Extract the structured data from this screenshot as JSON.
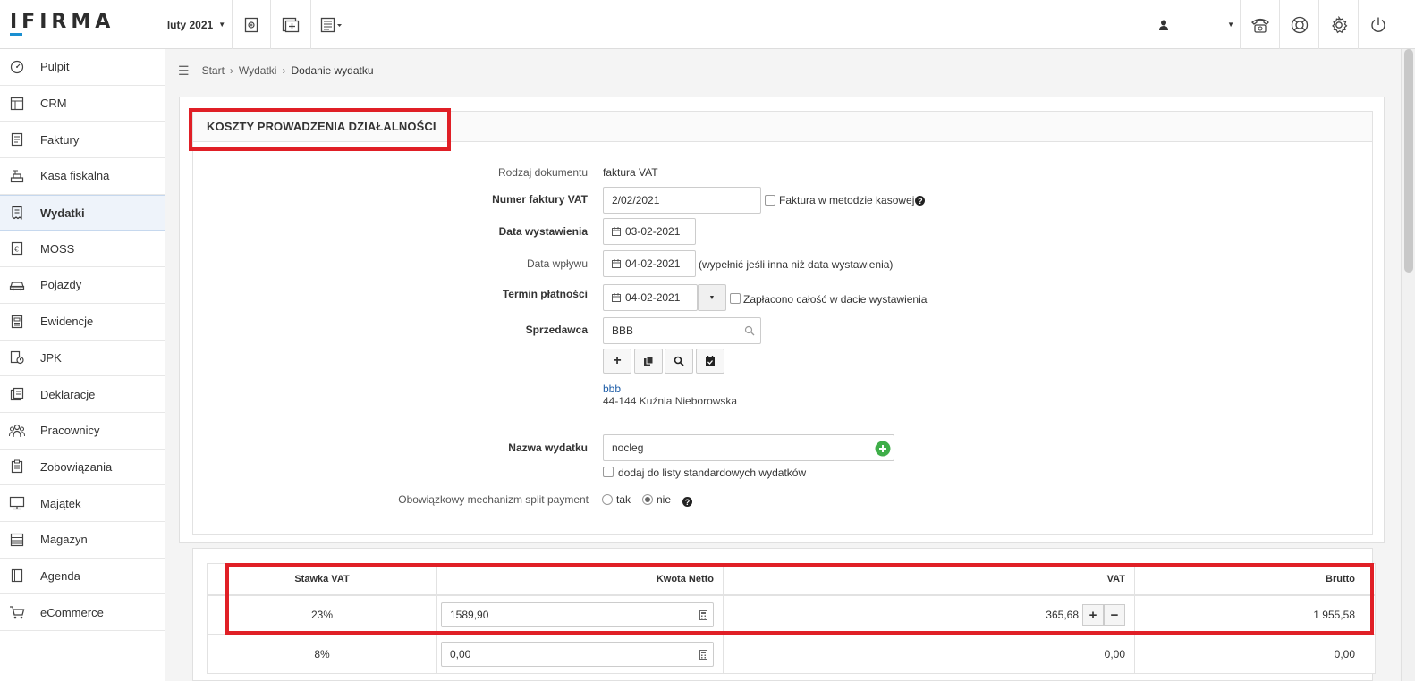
{
  "app": {
    "logo": "IFIRMA",
    "period": "luty 2021"
  },
  "sidebar": {
    "items": [
      {
        "label": "Pulpit",
        "icon": "dashboard-icon"
      },
      {
        "label": "CRM",
        "icon": "crm-icon"
      },
      {
        "label": "Faktury",
        "icon": "invoice-icon"
      },
      {
        "label": "Kasa fiskalna",
        "icon": "cash-register-icon"
      },
      {
        "label": "Wydatki",
        "icon": "receipt-icon",
        "active": true
      },
      {
        "label": "MOSS",
        "icon": "moss-icon"
      },
      {
        "label": "Pojazdy",
        "icon": "car-icon"
      },
      {
        "label": "Ewidencje",
        "icon": "ledger-icon"
      },
      {
        "label": "JPK",
        "icon": "jpk-icon"
      },
      {
        "label": "Deklaracje",
        "icon": "declaration-icon"
      },
      {
        "label": "Pracownicy",
        "icon": "employees-icon"
      },
      {
        "label": "Zobowiązania",
        "icon": "obligations-icon"
      },
      {
        "label": "Majątek",
        "icon": "assets-icon"
      },
      {
        "label": "Magazyn",
        "icon": "warehouse-icon"
      },
      {
        "label": "Agenda",
        "icon": "agenda-icon"
      },
      {
        "label": "eCommerce",
        "icon": "cart-icon"
      }
    ]
  },
  "breadcrumb": {
    "start": "Start",
    "expenses": "Wydatki",
    "current": "Dodanie wydatku"
  },
  "section": {
    "title": "KOSZTY PROWADZENIA DZIAŁALNOŚCI"
  },
  "form": {
    "doc_type_label": "Rodzaj dokumentu",
    "doc_type_value": "faktura VAT",
    "invoice_no_label": "Numer faktury VAT",
    "invoice_no_value": "2/02/2021",
    "cash_method_label": "Faktura w metodzie kasowej",
    "issue_date_label": "Data wystawienia",
    "issue_date_value": "03-02-2021",
    "receipt_date_label": "Data wpływu",
    "receipt_date_value": "04-02-2021",
    "receipt_date_hint": "(wypełnić jeśli inna niż data wystawienia)",
    "due_date_label": "Termin płatności",
    "due_date_value": "04-02-2021",
    "paid_label": "Zapłacono całość w dacie wystawienia",
    "seller_label": "Sprzedawca",
    "seller_value": "BBB",
    "seller_link": "bbb",
    "seller_address": "44-144 Kuźnia Nieborowska",
    "expense_name_label": "Nazwa wydatku",
    "expense_name_value": "nocleg",
    "add_standard_label": "dodaj do listy standardowych wydatków",
    "split_payment_label": "Obowiązkowy mechanizm split payment",
    "split_yes": "tak",
    "split_no": "nie",
    "split_selected": "nie"
  },
  "vat_table": {
    "headers": {
      "rate": "Stawka VAT",
      "net": "Kwota Netto",
      "vat": "VAT",
      "gross": "Brutto"
    },
    "rows": [
      {
        "rate": "23%",
        "net": "1589,90",
        "vat": "365,68",
        "gross": "1 955,58"
      },
      {
        "rate": "8%",
        "net": "0,00",
        "vat": "0,00",
        "gross": "0,00"
      }
    ]
  },
  "colors": {
    "highlight": "#e01f26",
    "accent": "#1a8fd1",
    "link": "#1f5ea8",
    "add_green": "#3fae49"
  }
}
